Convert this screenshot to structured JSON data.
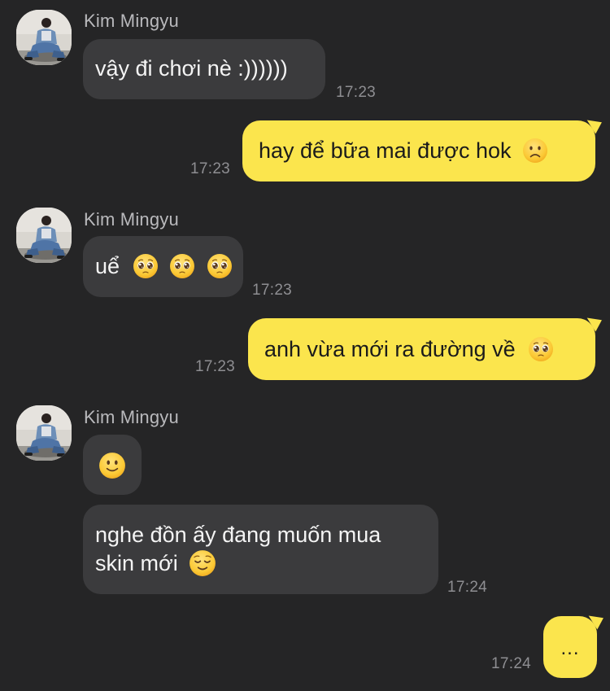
{
  "contact": {
    "name": "Kim Mingyu"
  },
  "messages": [
    {
      "dir": "in",
      "text": "vậy đi chơi nè :))))))",
      "time": "17:23"
    },
    {
      "dir": "out",
      "text": "hay để bữa mai được hok",
      "emoji": "frowning-face",
      "time": "17:23"
    },
    {
      "dir": "in",
      "text": "uể",
      "emoji": "pleading-face x3",
      "time": "17:23"
    },
    {
      "dir": "out",
      "text": "anh vừa mới ra đường về",
      "emoji": "pleading-face",
      "time": "17:23"
    },
    {
      "dir": "in",
      "emoji": "slightly-smiling-face"
    },
    {
      "dir": "in",
      "line1": "nghe đồn ấy đang muốn mua",
      "line2": "skin mới",
      "emoji": "relieved-face",
      "time": "17:24"
    },
    {
      "dir": "out",
      "text": "...",
      "time": "17:24"
    }
  ],
  "colors": {
    "background": "#252526",
    "incoming_bubble": "#3b3b3d",
    "outgoing_bubble": "#fbe54d",
    "timestamp": "#8e8e92",
    "sender_name": "#b9b9bc"
  }
}
